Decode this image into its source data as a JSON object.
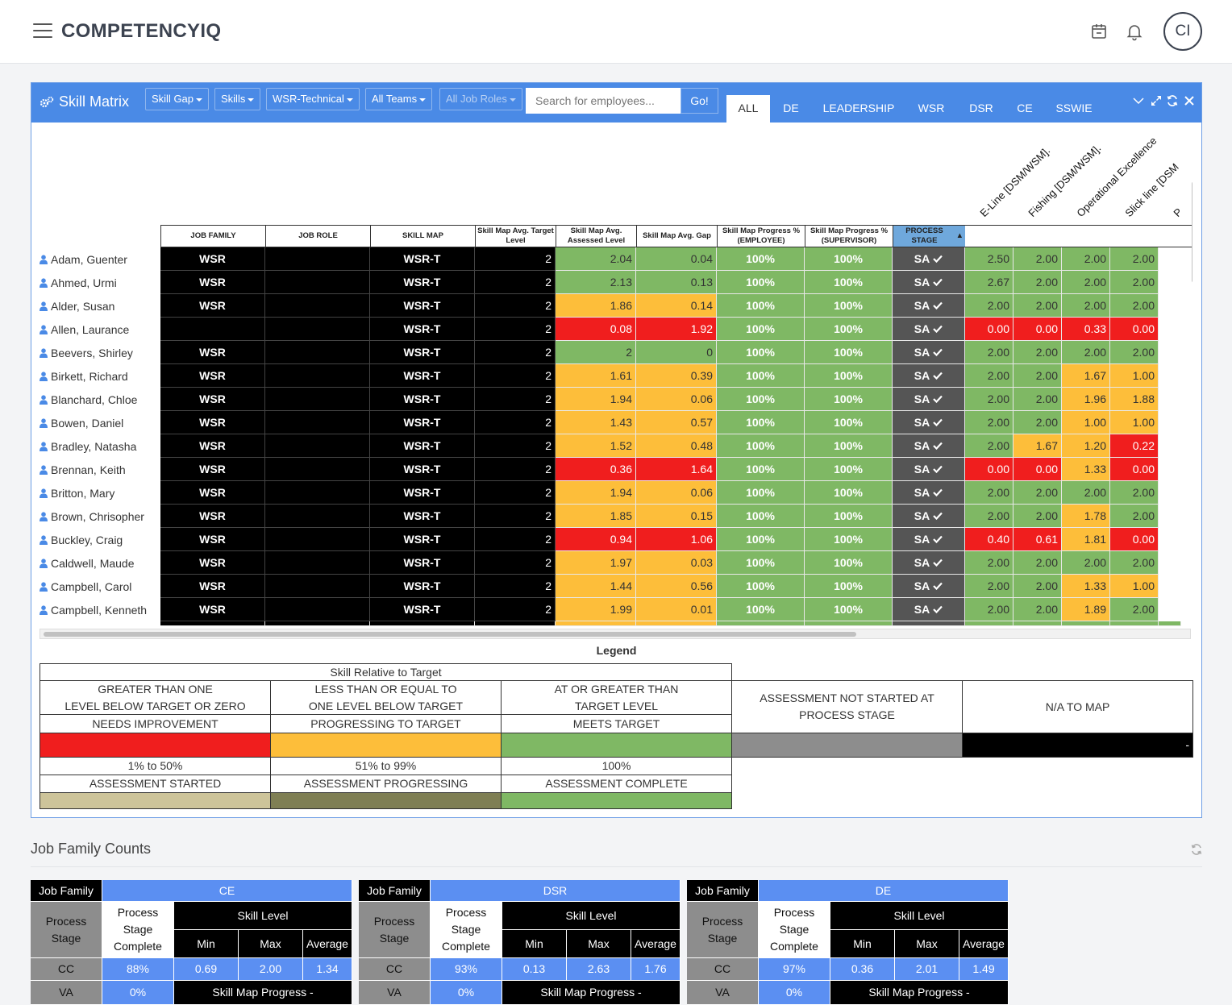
{
  "app": {
    "brand": "COMPETENCYIQ",
    "avatar_initials": "CI"
  },
  "panel": {
    "title": "Skill Matrix",
    "filters": [
      {
        "label": "Skill Gap",
        "disabled": false
      },
      {
        "label": "Skills",
        "disabled": false
      },
      {
        "label": "WSR-Technical",
        "disabled": false
      },
      {
        "label": "All Teams",
        "disabled": false
      },
      {
        "label": "All Job Roles",
        "disabled": true
      }
    ],
    "search_placeholder": "Search for employees...",
    "go_label": "Go!",
    "tabs": [
      "ALL",
      "DE",
      "LEADERSHIP",
      "WSR",
      "DSR",
      "CE",
      "SSWIE"
    ],
    "active_tab": "ALL"
  },
  "matrix": {
    "columns": [
      "JOB FAMILY",
      "JOB ROLE",
      "SKILL MAP",
      "Skill Map Avg. Target Level",
      "Skill Map Avg. Assessed Level",
      "Skill Map Avg. Gap",
      "Skill Map Progress % (EMPLOYEE)",
      "Skill Map Progress % (SUPERVISOR)",
      "PROCESS STAGE"
    ],
    "rotated_headers": [
      "E-Line [DSM/WSM].",
      "Fishing [DSM/WSM].",
      "Operational Excellence",
      "Slick line [DSM",
      "P"
    ],
    "rows": [
      {
        "name": "Adam, Guenter",
        "family": "WSR",
        "role": "",
        "map": "WSR-T",
        "target": "2",
        "assessed": "2.04",
        "gap": "0.04",
        "emp": "100%",
        "sup": "100%",
        "stage": "SA",
        "status": "green",
        "skills": [
          [
            "2.50",
            "green"
          ],
          [
            "2.00",
            "green"
          ],
          [
            "2.00",
            "green"
          ],
          [
            "2.00",
            "green"
          ]
        ]
      },
      {
        "name": "Ahmed, Urmi",
        "family": "WSR",
        "role": "",
        "map": "WSR-T",
        "target": "2",
        "assessed": "2.13",
        "gap": "0.13",
        "emp": "100%",
        "sup": "100%",
        "stage": "SA",
        "status": "green",
        "skills": [
          [
            "2.67",
            "green"
          ],
          [
            "2.00",
            "green"
          ],
          [
            "2.00",
            "green"
          ],
          [
            "2.00",
            "green"
          ]
        ]
      },
      {
        "name": "Alder, Susan",
        "family": "WSR",
        "role": "",
        "map": "WSR-T",
        "target": "2",
        "assessed": "1.86",
        "gap": "0.14",
        "emp": "100%",
        "sup": "100%",
        "stage": "SA",
        "status": "orange",
        "skills": [
          [
            "2.00",
            "green"
          ],
          [
            "2.00",
            "green"
          ],
          [
            "2.00",
            "green"
          ],
          [
            "2.00",
            "green"
          ]
        ]
      },
      {
        "name": "Allen, Laurance",
        "family": "",
        "role": "",
        "map": "WSR-T",
        "target": "2",
        "assessed": "0.08",
        "gap": "1.92",
        "emp": "100%",
        "sup": "100%",
        "stage": "SA",
        "status": "red",
        "skills": [
          [
            "0.00",
            "red"
          ],
          [
            "0.00",
            "red"
          ],
          [
            "0.33",
            "red"
          ],
          [
            "0.00",
            "red"
          ]
        ]
      },
      {
        "name": "Beevers, Shirley",
        "family": "WSR",
        "role": "",
        "map": "WSR-T",
        "target": "2",
        "assessed": "2",
        "gap": "0",
        "emp": "100%",
        "sup": "100%",
        "stage": "SA",
        "status": "green",
        "skills": [
          [
            "2.00",
            "green"
          ],
          [
            "2.00",
            "green"
          ],
          [
            "2.00",
            "green"
          ],
          [
            "2.00",
            "green"
          ]
        ]
      },
      {
        "name": "Birkett, Richard",
        "family": "WSR",
        "role": "",
        "map": "WSR-T",
        "target": "2",
        "assessed": "1.61",
        "gap": "0.39",
        "emp": "100%",
        "sup": "100%",
        "stage": "SA",
        "status": "orange",
        "skills": [
          [
            "2.00",
            "green"
          ],
          [
            "2.00",
            "green"
          ],
          [
            "1.67",
            "orange"
          ],
          [
            "1.00",
            "orange"
          ]
        ]
      },
      {
        "name": "Blanchard, Chloe",
        "family": "WSR",
        "role": "",
        "map": "WSR-T",
        "target": "2",
        "assessed": "1.94",
        "gap": "0.06",
        "emp": "100%",
        "sup": "100%",
        "stage": "SA",
        "status": "orange",
        "skills": [
          [
            "2.00",
            "green"
          ],
          [
            "2.00",
            "green"
          ],
          [
            "1.96",
            "orange"
          ],
          [
            "1.88",
            "orange"
          ]
        ]
      },
      {
        "name": "Bowen, Daniel",
        "family": "WSR",
        "role": "",
        "map": "WSR-T",
        "target": "2",
        "assessed": "1.43",
        "gap": "0.57",
        "emp": "100%",
        "sup": "100%",
        "stage": "SA",
        "status": "orange",
        "skills": [
          [
            "2.00",
            "green"
          ],
          [
            "2.00",
            "green"
          ],
          [
            "1.00",
            "orange"
          ],
          [
            "1.00",
            "orange"
          ]
        ]
      },
      {
        "name": "Bradley, Natasha",
        "family": "WSR",
        "role": "",
        "map": "WSR-T",
        "target": "2",
        "assessed": "1.52",
        "gap": "0.48",
        "emp": "100%",
        "sup": "100%",
        "stage": "SA",
        "status": "orange",
        "skills": [
          [
            "2.00",
            "green"
          ],
          [
            "1.67",
            "orange"
          ],
          [
            "1.20",
            "orange"
          ],
          [
            "0.22",
            "red"
          ]
        ]
      },
      {
        "name": "Brennan, Keith",
        "family": "WSR",
        "role": "",
        "map": "WSR-T",
        "target": "2",
        "assessed": "0.36",
        "gap": "1.64",
        "emp": "100%",
        "sup": "100%",
        "stage": "SA",
        "status": "red",
        "skills": [
          [
            "0.00",
            "red"
          ],
          [
            "0.00",
            "red"
          ],
          [
            "1.33",
            "orange"
          ],
          [
            "0.00",
            "red"
          ]
        ]
      },
      {
        "name": "Britton, Mary",
        "family": "WSR",
        "role": "",
        "map": "WSR-T",
        "target": "2",
        "assessed": "1.94",
        "gap": "0.06",
        "emp": "100%",
        "sup": "100%",
        "stage": "SA",
        "status": "orange",
        "skills": [
          [
            "2.00",
            "green"
          ],
          [
            "2.00",
            "green"
          ],
          [
            "2.00",
            "green"
          ],
          [
            "2.00",
            "green"
          ]
        ]
      },
      {
        "name": "Brown, Chrisopher",
        "family": "WSR",
        "role": "",
        "map": "WSR-T",
        "target": "2",
        "assessed": "1.85",
        "gap": "0.15",
        "emp": "100%",
        "sup": "100%",
        "stage": "SA",
        "status": "orange",
        "skills": [
          [
            "2.00",
            "green"
          ],
          [
            "2.00",
            "green"
          ],
          [
            "1.78",
            "orange"
          ],
          [
            "2.00",
            "green"
          ]
        ]
      },
      {
        "name": "Buckley, Craig",
        "family": "WSR",
        "role": "",
        "map": "WSR-T",
        "target": "2",
        "assessed": "0.94",
        "gap": "1.06",
        "emp": "100%",
        "sup": "100%",
        "stage": "SA",
        "status": "red",
        "skills": [
          [
            "0.40",
            "red"
          ],
          [
            "0.61",
            "red"
          ],
          [
            "1.81",
            "orange"
          ],
          [
            "0.00",
            "red"
          ]
        ]
      },
      {
        "name": "Caldwell, Maude",
        "family": "WSR",
        "role": "",
        "map": "WSR-T",
        "target": "2",
        "assessed": "1.97",
        "gap": "0.03",
        "emp": "100%",
        "sup": "100%",
        "stage": "SA",
        "status": "orange",
        "skills": [
          [
            "2.00",
            "green"
          ],
          [
            "2.00",
            "green"
          ],
          [
            "2.00",
            "green"
          ],
          [
            "2.00",
            "green"
          ]
        ]
      },
      {
        "name": "Campbell, Carol",
        "family": "WSR",
        "role": "",
        "map": "WSR-T",
        "target": "2",
        "assessed": "1.44",
        "gap": "0.56",
        "emp": "100%",
        "sup": "100%",
        "stage": "SA",
        "status": "orange",
        "skills": [
          [
            "2.00",
            "green"
          ],
          [
            "2.00",
            "green"
          ],
          [
            "1.33",
            "orange"
          ],
          [
            "1.00",
            "orange"
          ]
        ]
      },
      {
        "name": "Campbell, Kenneth",
        "family": "WSR",
        "role": "",
        "map": "WSR-T",
        "target": "2",
        "assessed": "1.99",
        "gap": "0.01",
        "emp": "100%",
        "sup": "100%",
        "stage": "SA",
        "status": "orange",
        "skills": [
          [
            "2.00",
            "green"
          ],
          [
            "2.00",
            "green"
          ],
          [
            "1.89",
            "orange"
          ],
          [
            "2.00",
            "green"
          ]
        ]
      }
    ]
  },
  "legend": {
    "title": "Legend",
    "skill_relative": "Skill Relative to Target",
    "col1": {
      "line1": "GREATER THAN ONE",
      "line2": "LEVEL BELOW TARGET OR ZERO",
      "status": "NEEDS IMPROVEMENT",
      "pct": "1% to 50%",
      "assessment": "ASSESSMENT STARTED"
    },
    "col2": {
      "line1": "LESS THAN OR EQUAL TO",
      "line2": "ONE LEVEL BELOW TARGET",
      "status": "PROGRESSING TO TARGET",
      "pct": "51% to 99%",
      "assessment": "ASSESSMENT PROGRESSING"
    },
    "col3": {
      "line1": "AT OR GREATER THAN",
      "line2": "TARGET LEVEL",
      "status": "MEETS TARGET",
      "pct": "100%",
      "assessment": "ASSESSMENT COMPLETE"
    },
    "not_started": "ASSESSMENT NOT STARTED AT PROCESS STAGE",
    "na": "N/A TO MAP",
    "na_value": "-"
  },
  "job_family_counts": {
    "title": "Job Family Counts",
    "labels": {
      "job_family": "Job Family",
      "process_stage": "Process Stage",
      "stage_complete": "Process Stage Complete",
      "skill_level": "Skill Level",
      "min": "Min",
      "max": "Max",
      "average": "Average",
      "skill_map_progress": "Skill Map Progress -"
    },
    "tables": [
      {
        "family": "CE",
        "cc": {
          "stage": "CC",
          "complete": "88%",
          "min": "0.69",
          "max": "2.00",
          "avg": "1.34"
        },
        "va": {
          "stage": "VA",
          "complete": "0%"
        }
      },
      {
        "family": "DSR",
        "cc": {
          "stage": "CC",
          "complete": "93%",
          "min": "0.13",
          "max": "2.63",
          "avg": "1.76"
        },
        "va": {
          "stage": "VA",
          "complete": "0%"
        }
      },
      {
        "family": "DE",
        "cc": {
          "stage": "CC",
          "complete": "97%",
          "min": "0.36",
          "max": "2.01",
          "avg": "1.49"
        },
        "va": {
          "stage": "VA",
          "complete": "0%"
        }
      }
    ]
  }
}
